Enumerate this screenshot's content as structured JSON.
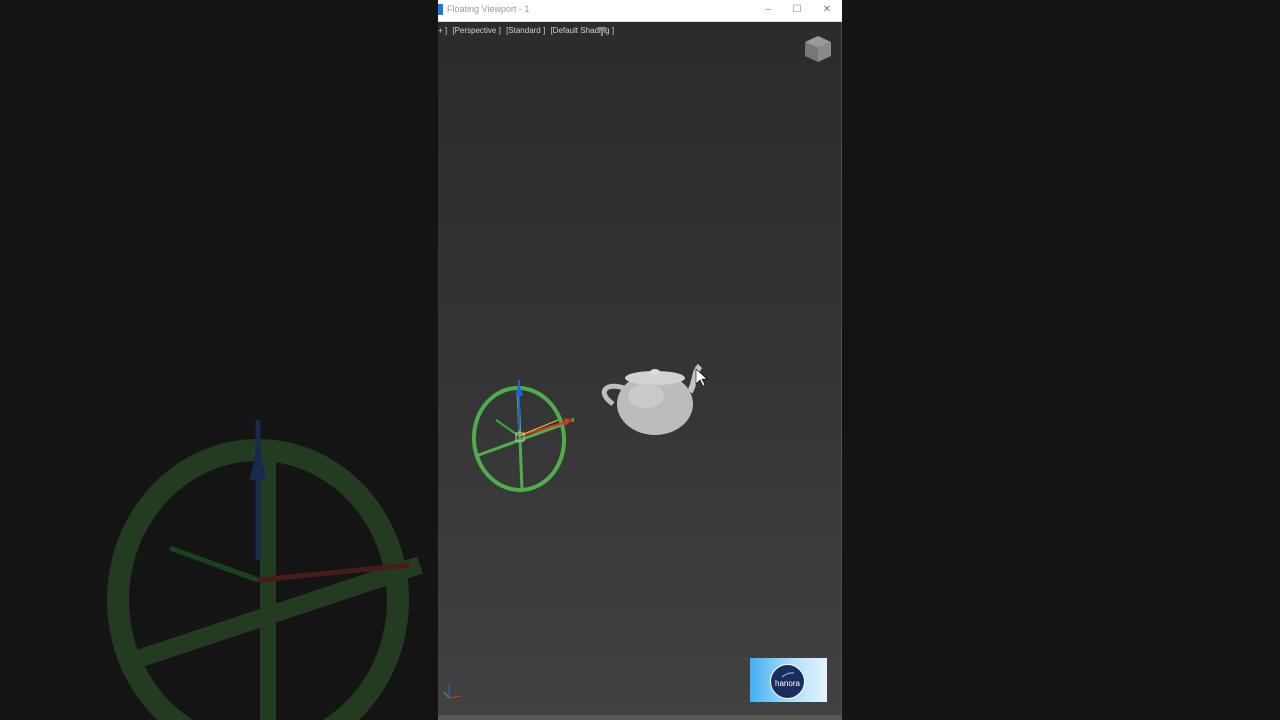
{
  "window": {
    "title": "Floating Viewport - 1",
    "minimize_symbol": "–",
    "maximize_symbol": "☐",
    "close_symbol": "✕"
  },
  "viewport": {
    "labels": [
      "+ ]",
      "[Perspective ]",
      "[Standard ]",
      "[Default Shading ]"
    ],
    "filter_icon": "funnel-icon",
    "viewcube_icon": "viewcube-icon"
  },
  "scene": {
    "objects": [
      "circle-gizmo",
      "teapot"
    ],
    "axis_labels": {
      "x": "x",
      "y": "y",
      "z": "z"
    }
  },
  "logo": {
    "text": "hanora"
  },
  "colors": {
    "gizmo_ring": "#4fae4a",
    "axis_x": "#d8322a",
    "axis_y": "#2fae3a",
    "axis_z": "#2060e0",
    "title_bar": "#ffffff",
    "logo_badge": "#1b2d5a"
  }
}
